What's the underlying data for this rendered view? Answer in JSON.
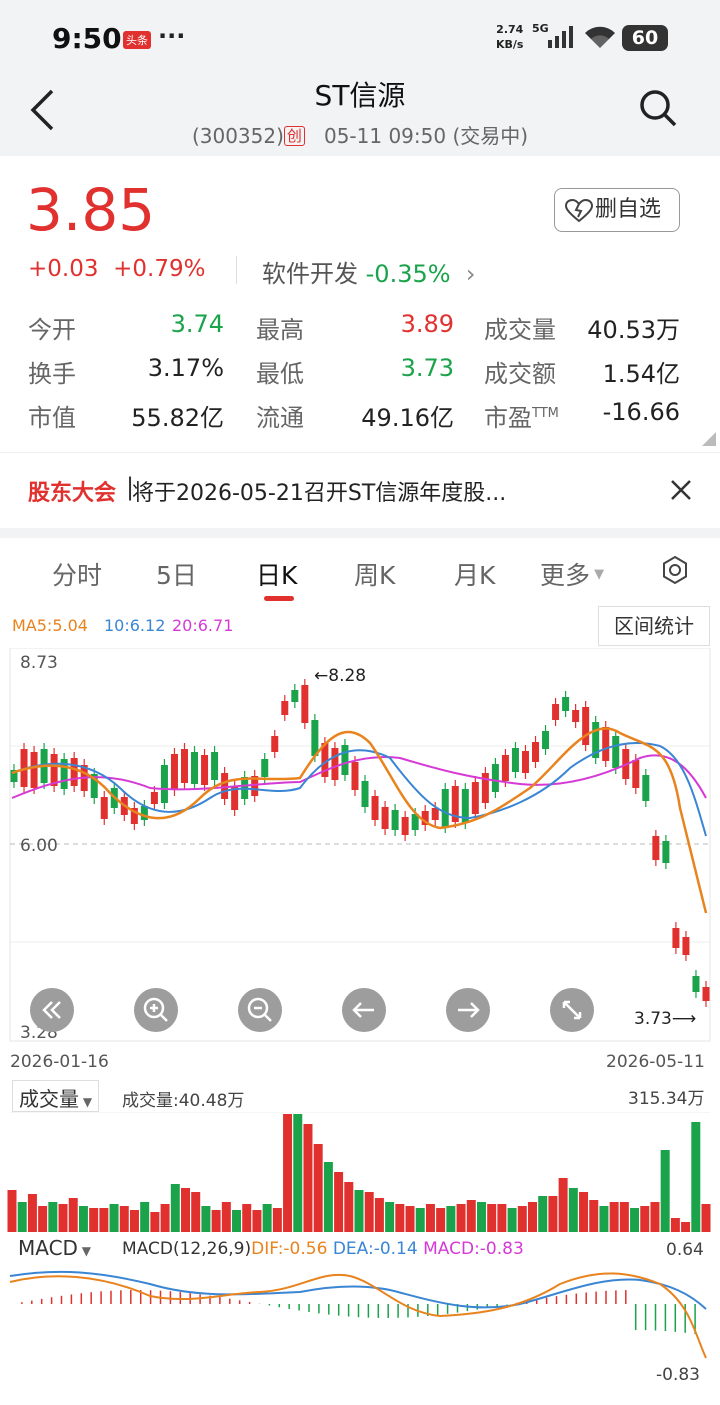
{
  "status": {
    "time": "9:50",
    "badge": "头条",
    "more": "···",
    "net_speed": "2.74",
    "net_unit": "KB/s",
    "network": "5G",
    "battery": "60"
  },
  "header": {
    "title": "ST信源",
    "code": "(300352)",
    "board": "创",
    "datetime": "05-11 09:50",
    "state": "(交易中)"
  },
  "quote": {
    "price": "3.85",
    "change": "+0.03",
    "change_pct": "+0.79%",
    "sector": "软件开发",
    "sector_change": "-0.35%",
    "watch_button": "删自选",
    "stats": [
      {
        "label": "今开",
        "value": "3.74"
      },
      {
        "label": "最高",
        "value": "3.89"
      },
      {
        "label": "成交量",
        "value": "40.53万"
      },
      {
        "label": "换手",
        "value": "3.17%"
      },
      {
        "label": "最低",
        "value": "3.73"
      },
      {
        "label": "成交额",
        "value": "1.54亿"
      },
      {
        "label": "市值",
        "value": "55.82亿"
      },
      {
        "label": "流通",
        "value": "49.16亿"
      },
      {
        "label": "市盈",
        "sup": "TTM",
        "value": "-16.66"
      }
    ]
  },
  "notice": {
    "tag": "股东大会",
    "text": "将于2026-05-21召开ST信源年度股..."
  },
  "tabs": [
    "分时",
    "5日",
    "日K",
    "周K",
    "月K",
    "更多"
  ],
  "active_tab": "日K",
  "ma": {
    "ma5": "MA5:5.04",
    "ma10": "10:6.12",
    "ma20": "20:6.71"
  },
  "range_button": "区间统计",
  "kline": {
    "y_top": "8.73",
    "y_mid": "6.00",
    "y_bottom": "3.28",
    "high_mark": "8.28",
    "low_mark": "3.73",
    "date_start": "2026-01-16",
    "date_end": "2026-05-11"
  },
  "volume": {
    "selector": "成交量",
    "info": "成交量:40.48万",
    "max": "315.34万"
  },
  "macd": {
    "selector": "MACD",
    "params": "MACD(12,26,9)",
    "dif": "DIF:-0.56",
    "dea": "DEA:-0.14",
    "macd": "MACD:-0.83",
    "max": "0.64",
    "min": "-0.83"
  },
  "colors": {
    "up": "#e0312f",
    "down": "#1aa34a",
    "ma5": "#e8831e",
    "ma10": "#3a86d4",
    "ma20": "#d63ad6"
  }
}
